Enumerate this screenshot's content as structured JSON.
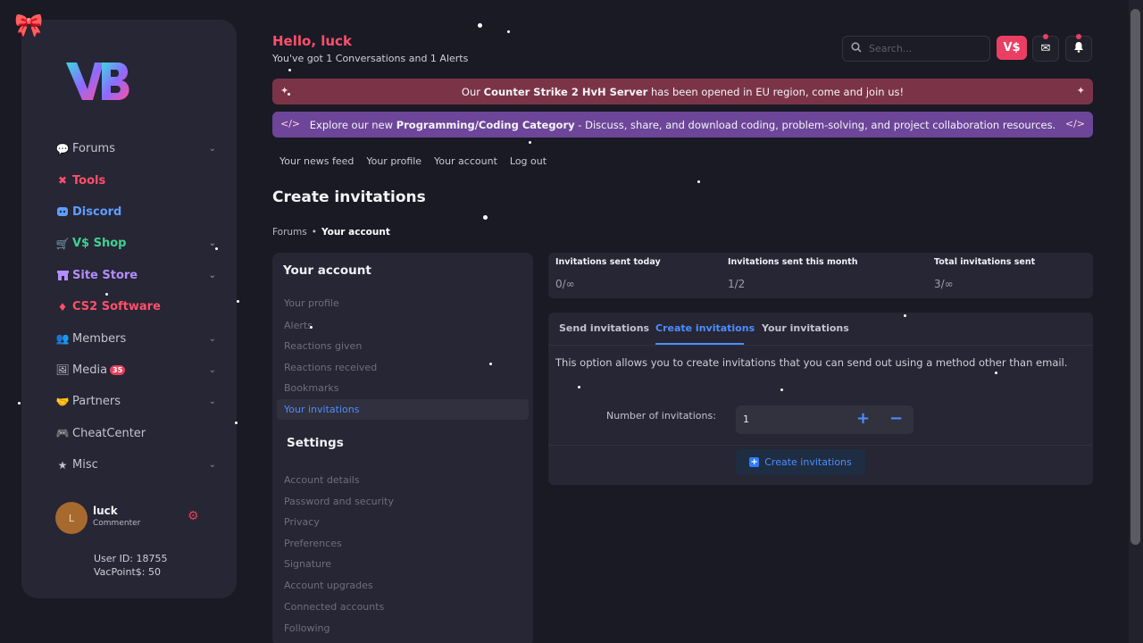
{
  "sidebar": {
    "logo_text": "VB",
    "nav": [
      {
        "label": "Forums",
        "icon": "comments-icon",
        "chevron": true
      },
      {
        "label": "Tools",
        "icon": "wrench-icon",
        "chevron": false
      },
      {
        "label": "Discord",
        "icon": "discord-icon",
        "chevron": false
      },
      {
        "label": "V$ Shop",
        "icon": "cart-icon",
        "chevron": true
      },
      {
        "label": "Site Store",
        "icon": "store-icon",
        "chevron": true
      },
      {
        "label": "CS2 Software",
        "icon": "gem-icon",
        "chevron": false
      },
      {
        "label": "Members",
        "icon": "users-icon",
        "chevron": true
      },
      {
        "label": "Media",
        "icon": "image-icon",
        "chevron": true,
        "badge": "35"
      },
      {
        "label": "Partners",
        "icon": "handshake-icon",
        "chevron": true
      },
      {
        "label": "CheatCenter",
        "icon": "gamepad-icon",
        "chevron": false
      },
      {
        "label": "Misc",
        "icon": "star-icon",
        "chevron": true
      }
    ],
    "user": {
      "avatar_letter": "L",
      "name": "luck",
      "role": "Commenter",
      "user_id_line": "User ID: 18755",
      "points_line": "VacPoint$: 50"
    }
  },
  "header": {
    "greeting": "Hello, luck",
    "subtitle": "You've got 1 Conversations and 1 Alerts",
    "search_placeholder": "Search...",
    "currency_label": "V$"
  },
  "banners": {
    "red": {
      "pre": "Our ",
      "bold": "Counter Strike 2 HvH Server",
      "post": " has been opened in EU region, come and join us!"
    },
    "purple": {
      "pre": "Explore our new ",
      "bold": "Programming/Coding Category",
      "post": " - Discuss, share, and download coding, problem-solving, and project collaboration resources."
    }
  },
  "subnav": [
    "Your news feed",
    "Your profile",
    "Your account",
    "Log out"
  ],
  "page": {
    "title": "Create invitations",
    "breadcrumb": [
      "Forums",
      "Your account"
    ]
  },
  "account": {
    "heading": "Your account",
    "links": [
      "Your profile",
      "Alerts",
      "Reactions given",
      "Reactions received",
      "Bookmarks",
      "Your invitations"
    ],
    "settings_heading": "Settings",
    "settings_links": [
      "Account details",
      "Password and security",
      "Privacy",
      "Preferences",
      "Signature",
      "Account upgrades",
      "Connected accounts",
      "Following"
    ]
  },
  "stats": [
    {
      "label": "Invitations sent today",
      "value": "0/∞"
    },
    {
      "label": "Invitations sent this month",
      "value": "1/2"
    },
    {
      "label": "Total invitations sent",
      "value": "3/∞"
    }
  ],
  "invitations": {
    "tabs": [
      "Send invitations",
      "Create invitations",
      "Your invitations"
    ],
    "description": "This option allows you to create invitations that you can send out using a method other than email.",
    "number_label": "Number of invitations:",
    "number_value": "1",
    "create_button": "Create invitations"
  },
  "colors": {
    "accent": "#4d8dff",
    "brand_red": "#ea3f63",
    "banner_red": "#7b3447",
    "banner_purple": "#6d4599"
  }
}
